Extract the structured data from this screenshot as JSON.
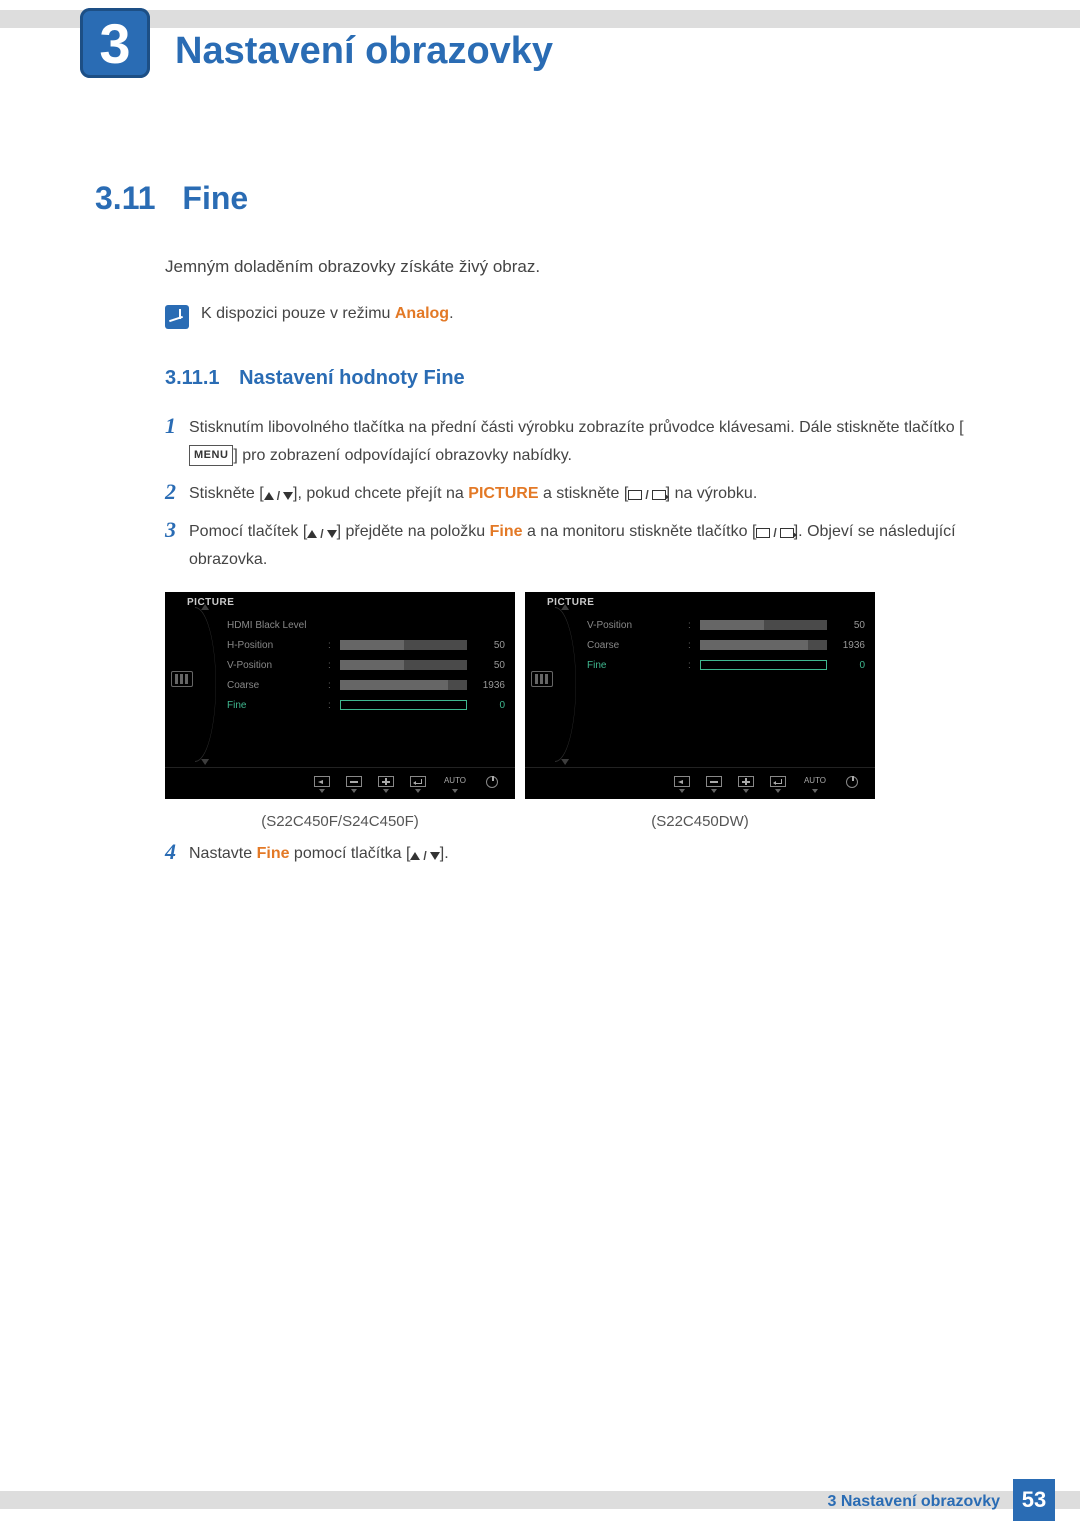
{
  "chapter": {
    "number": "3",
    "title": "Nastavení obrazovky"
  },
  "section": {
    "number": "3.11",
    "title": "Fine"
  },
  "intro": "Jemným doladěním obrazovky získáte živý obraz.",
  "note": {
    "prefix": "K dispozici pouze v režimu ",
    "highlight": "Analog",
    "suffix": "."
  },
  "subsection": {
    "number": "3.11.1",
    "title": "Nastavení hodnoty Fine"
  },
  "steps": {
    "s1": {
      "num": "1",
      "t1": "Stisknutím libovolného tlačítka na přední části výrobku zobrazíte průvodce klávesami. Dále stiskněte tlačítko [",
      "menu": "MENU",
      "t2": "] pro zobrazení odpovídající obrazovky nabídky."
    },
    "s2": {
      "num": "2",
      "t1": "Stiskněte [",
      "t2": "], pokud chcete přejít na ",
      "hl": "PICTURE",
      "t3": " a stiskněte [",
      "t4": "] na výrobku."
    },
    "s3": {
      "num": "3",
      "t1": "Pomocí tlačítek [",
      "t2": "] přejděte na položku ",
      "hl": "Fine",
      "t3": " a na monitoru stiskněte tlačítko [",
      "t4": "]. Objeví se následující obrazovka."
    },
    "s4": {
      "num": "4",
      "t1": "Nastavte ",
      "hl": "Fine",
      "t2": " pomocí tlačítka [",
      "t3": "]."
    }
  },
  "osd": {
    "header": "PICTURE",
    "auto": "AUTO",
    "panel1": {
      "rows": [
        {
          "label": "HDMI Black Level",
          "value": "",
          "fill": 0,
          "hl": false,
          "bar": false
        },
        {
          "label": "H-Position",
          "value": "50",
          "fill": 50,
          "hl": false,
          "bar": true
        },
        {
          "label": "V-Position",
          "value": "50",
          "fill": 50,
          "hl": false,
          "bar": true
        },
        {
          "label": "Coarse",
          "value": "1936",
          "fill": 85,
          "hl": false,
          "bar": true
        },
        {
          "label": "Fine",
          "value": "0",
          "fill": 0,
          "hl": true,
          "bar": true
        }
      ],
      "caption": "(S22C450F/S24C450F)"
    },
    "panel2": {
      "rows": [
        {
          "label": "V-Position",
          "value": "50",
          "fill": 50,
          "hl": false,
          "bar": true
        },
        {
          "label": "Coarse",
          "value": "1936",
          "fill": 85,
          "hl": false,
          "bar": true
        },
        {
          "label": "Fine",
          "value": "0",
          "fill": 0,
          "hl": true,
          "bar": true
        }
      ],
      "caption": "(S22C450DW)"
    }
  },
  "footer": {
    "text": "3 Nastavení obrazovky",
    "page": "53"
  }
}
